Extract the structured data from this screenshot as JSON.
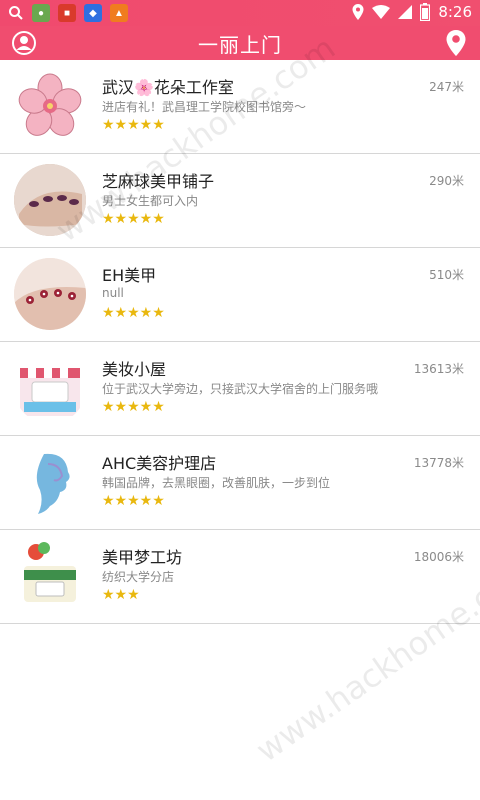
{
  "status_bar": {
    "time": "8:26"
  },
  "header": {
    "title": "一丽上门"
  },
  "shops": [
    {
      "name": "武汉🌸花朵工作室",
      "desc": "进店有礼！武昌理工学院校图书馆旁～",
      "stars": "★★★★★",
      "distance": "247米"
    },
    {
      "name": "芝麻球美甲铺子",
      "desc": "男士女生都可入内",
      "stars": "★★★★★",
      "distance": "290米"
    },
    {
      "name": "EH美甲",
      "desc": "null",
      "stars": "★★★★★",
      "distance": "510米"
    },
    {
      "name": "美妆小屋",
      "desc": "位于武汉大学旁边，只接武汉大学宿舍的上门服务哦",
      "stars": "★★★★★",
      "distance": "13613米"
    },
    {
      "name": "AHC美容护理店",
      "desc": "韩国品牌，去黑眼圈，改善肌肤，一步到位",
      "stars": "★★★★★",
      "distance": "13778米"
    },
    {
      "name": "美甲梦工坊",
      "desc": "纺织大学分店",
      "stars": "★★★",
      "distance": "18006米"
    }
  ],
  "watermark": {
    "text1": "www.hackhome.com",
    "text2": "www.hackhome.com"
  }
}
